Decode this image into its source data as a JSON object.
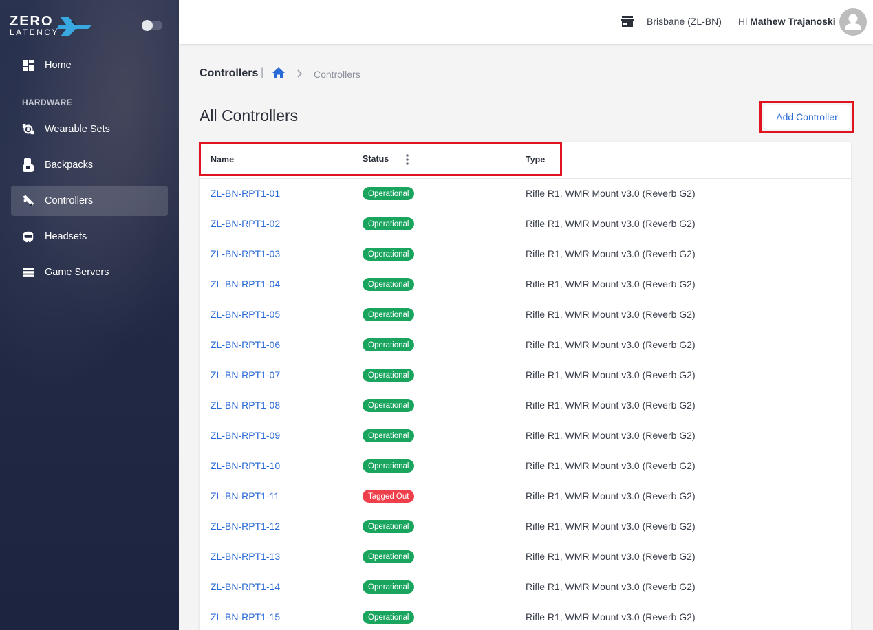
{
  "brand": {
    "name_top": "ZERO",
    "name_bottom": "LATENCY",
    "colors": {
      "wing": "#39a8e0",
      "sidebar": "#222a45",
      "accent": "#2a6ad6",
      "operational": "#1aa55f",
      "tagged_out": "#ef3f4b",
      "highlight": "#e0141e"
    }
  },
  "sidebar": {
    "items": [
      {
        "label": "Home",
        "icon": "dashboard-icon"
      },
      {
        "label": "Wearable Sets",
        "icon": "wearable-icon"
      },
      {
        "label": "Backpacks",
        "icon": "backpack-icon"
      },
      {
        "label": "Controllers",
        "icon": "controller-icon",
        "active": true
      },
      {
        "label": "Headsets",
        "icon": "headset-icon"
      },
      {
        "label": "Game Servers",
        "icon": "server-icon"
      }
    ],
    "section_hardware": "HARDWARE"
  },
  "topbar": {
    "site": "Brisbane (ZL-BN)",
    "greeting_prefix": "Hi",
    "user_name": "Mathew Trajanoski"
  },
  "breadcrumb": {
    "title": "Controllers",
    "separator": "|",
    "current": "Controllers"
  },
  "page": {
    "title": "All Controllers",
    "add_button": "Add Controller"
  },
  "table": {
    "columns": {
      "name": "Name",
      "status": "Status",
      "type": "Type"
    },
    "rows": [
      {
        "name": "ZL-BN-RPT1-01",
        "status": "Operational",
        "type": "Rifle R1, WMR Mount v3.0 (Reverb G2)"
      },
      {
        "name": "ZL-BN-RPT1-02",
        "status": "Operational",
        "type": "Rifle R1, WMR Mount v3.0 (Reverb G2)"
      },
      {
        "name": "ZL-BN-RPT1-03",
        "status": "Operational",
        "type": "Rifle R1, WMR Mount v3.0 (Reverb G2)"
      },
      {
        "name": "ZL-BN-RPT1-04",
        "status": "Operational",
        "type": "Rifle R1, WMR Mount v3.0 (Reverb G2)"
      },
      {
        "name": "ZL-BN-RPT1-05",
        "status": "Operational",
        "type": "Rifle R1, WMR Mount v3.0 (Reverb G2)"
      },
      {
        "name": "ZL-BN-RPT1-06",
        "status": "Operational",
        "type": "Rifle R1, WMR Mount v3.0 (Reverb G2)"
      },
      {
        "name": "ZL-BN-RPT1-07",
        "status": "Operational",
        "type": "Rifle R1, WMR Mount v3.0 (Reverb G2)"
      },
      {
        "name": "ZL-BN-RPT1-08",
        "status": "Operational",
        "type": "Rifle R1, WMR Mount v3.0 (Reverb G2)"
      },
      {
        "name": "ZL-BN-RPT1-09",
        "status": "Operational",
        "type": "Rifle R1, WMR Mount v3.0 (Reverb G2)"
      },
      {
        "name": "ZL-BN-RPT1-10",
        "status": "Operational",
        "type": "Rifle R1, WMR Mount v3.0 (Reverb G2)"
      },
      {
        "name": "ZL-BN-RPT1-11",
        "status": "Tagged Out",
        "type": "Rifle R1, WMR Mount v3.0 (Reverb G2)"
      },
      {
        "name": "ZL-BN-RPT1-12",
        "status": "Operational",
        "type": "Rifle R1, WMR Mount v3.0 (Reverb G2)"
      },
      {
        "name": "ZL-BN-RPT1-13",
        "status": "Operational",
        "type": "Rifle R1, WMR Mount v3.0 (Reverb G2)"
      },
      {
        "name": "ZL-BN-RPT1-14",
        "status": "Operational",
        "type": "Rifle R1, WMR Mount v3.0 (Reverb G2)"
      },
      {
        "name": "ZL-BN-RPT1-15",
        "status": "Operational",
        "type": "Rifle R1, WMR Mount v3.0 (Reverb G2)"
      }
    ]
  }
}
